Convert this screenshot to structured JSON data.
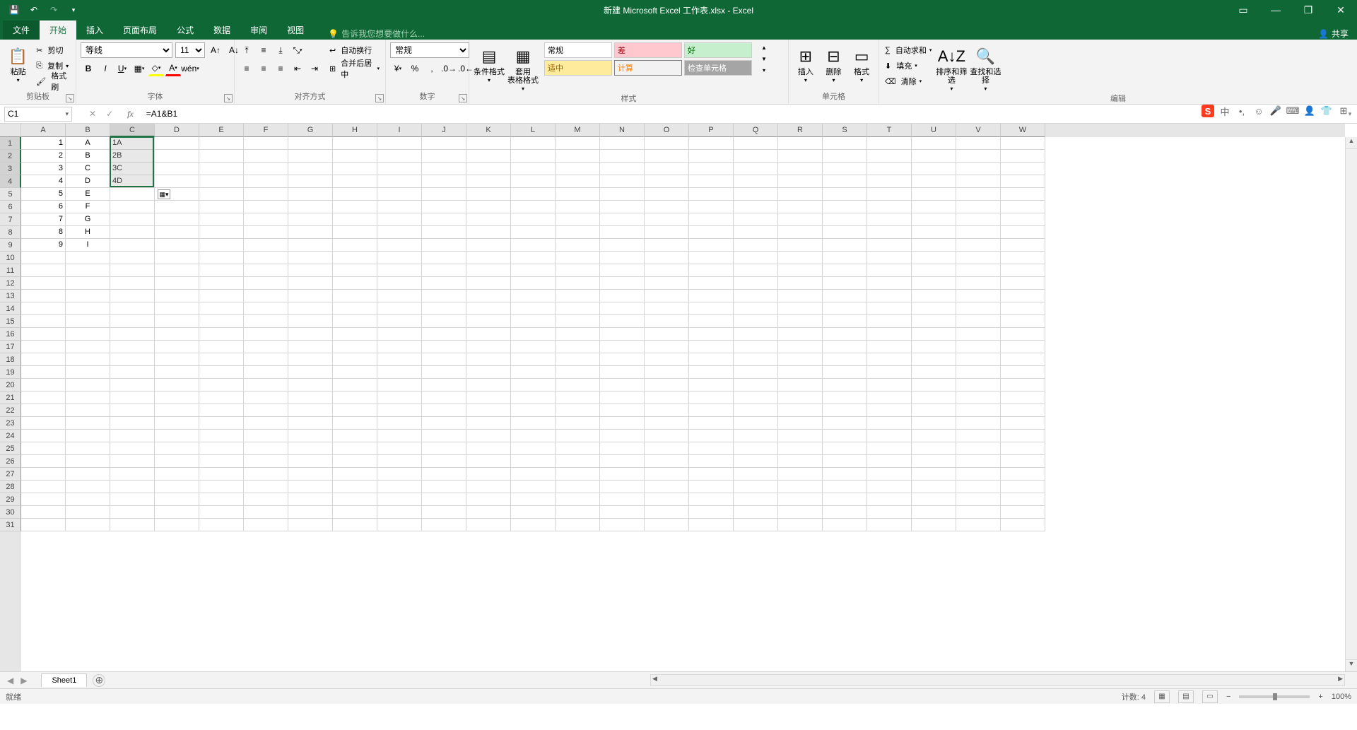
{
  "app": {
    "title": "新建 Microsoft Excel 工作表.xlsx - Excel"
  },
  "qat": {
    "save": "💾",
    "undo": "↶",
    "redo": "↷"
  },
  "winctrl": {
    "opts": "▭",
    "min": "—",
    "max": "❐",
    "close": "✕"
  },
  "tabs": {
    "file": "文件",
    "home": "开始",
    "insert": "插入",
    "layout": "页面布局",
    "formulas": "公式",
    "data": "数据",
    "review": "审阅",
    "view": "视图",
    "tell": "告诉我您想要做什么...",
    "share": "共享"
  },
  "ribbon": {
    "clipboard": {
      "label": "剪贴板",
      "paste": "粘贴",
      "cut": "剪切",
      "copy": "复制",
      "painter": "格式刷"
    },
    "font": {
      "label": "字体",
      "name": "等线",
      "size": "11"
    },
    "align": {
      "label": "对齐方式",
      "wrap": "自动换行",
      "merge": "合并后居中"
    },
    "number": {
      "label": "数字",
      "format": "常规"
    },
    "styles": {
      "label": "样式",
      "cond": "条件格式",
      "table": "套用\n表格格式",
      "normal": "常规",
      "bad": "差",
      "good": "好",
      "neutral": "适中",
      "calc": "计算",
      "check": "检查单元格"
    },
    "cells": {
      "label": "单元格",
      "insert": "插入",
      "delete": "删除",
      "format": "格式"
    },
    "editing": {
      "label": "编辑",
      "sum": "自动求和",
      "fill": "填充",
      "clear": "清除",
      "sort": "排序和筛选",
      "find": "查找和选择"
    }
  },
  "formula": {
    "namebox": "C1",
    "value": "=A1&B1"
  },
  "columns": [
    "A",
    "B",
    "C",
    "D",
    "E",
    "F",
    "G",
    "H",
    "I",
    "J",
    "K",
    "L",
    "M",
    "N",
    "O",
    "P",
    "Q",
    "R",
    "S",
    "T",
    "U",
    "V",
    "W"
  ],
  "rows": 31,
  "selectedCol": 2,
  "selectedRows": [
    0,
    1,
    2,
    3
  ],
  "celldata": {
    "A": [
      "1",
      "2",
      "3",
      "4",
      "5",
      "6",
      "7",
      "8",
      "9"
    ],
    "B": [
      "A",
      "B",
      "C",
      "D",
      "E",
      "F",
      "G",
      "H",
      "I"
    ],
    "C": [
      "1A",
      "2B",
      "3C",
      "4D"
    ]
  },
  "selection": {
    "col": 2,
    "rowStart": 0,
    "rowEnd": 3
  },
  "sheet": {
    "name": "Sheet1"
  },
  "status": {
    "ready": "就绪",
    "count_label": "计数:",
    "count": "4",
    "zoom": "100%"
  },
  "ime": {
    "s": "S",
    "zh": "中"
  }
}
